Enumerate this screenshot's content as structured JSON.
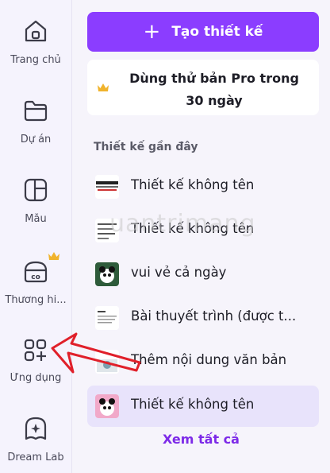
{
  "rail": {
    "items": [
      {
        "label": "Trang chủ",
        "icon": "home-icon"
      },
      {
        "label": "Dự án",
        "icon": "folder-icon"
      },
      {
        "label": "Mẫu",
        "icon": "template-icon"
      },
      {
        "label": "Thương hi...",
        "icon": "brand-icon"
      },
      {
        "label": "Ứng dụng",
        "icon": "apps-icon"
      },
      {
        "label": "Dream Lab",
        "icon": "dream-lab-icon"
      }
    ]
  },
  "main": {
    "create_label": "Tạo thiết kế",
    "pro_trial_line1": "Dùng thử bản Pro trong",
    "pro_trial_line2": "30 ngày",
    "recent_title": "Thiết kế gần đây",
    "recent": [
      {
        "label": "Thiết kế không tên",
        "active": false
      },
      {
        "label": "Thiết kế không tên",
        "active": false
      },
      {
        "label": "vui vẻ cả ngày",
        "active": false
      },
      {
        "label": "Bài thuyết trình (được t...",
        "active": false
      },
      {
        "label": "Thêm nội dung văn bản",
        "active": false
      },
      {
        "label": "Thiết kế không tên",
        "active": true
      }
    ],
    "see_all": "Xem tất cả"
  },
  "watermark": "uantrimang",
  "colors": {
    "accent": "#8b3dff",
    "accent_text": "#7d2ae8",
    "crown": "#f0b32c",
    "arrow": "#e0202a",
    "active_bg": "#e8e3fb"
  }
}
